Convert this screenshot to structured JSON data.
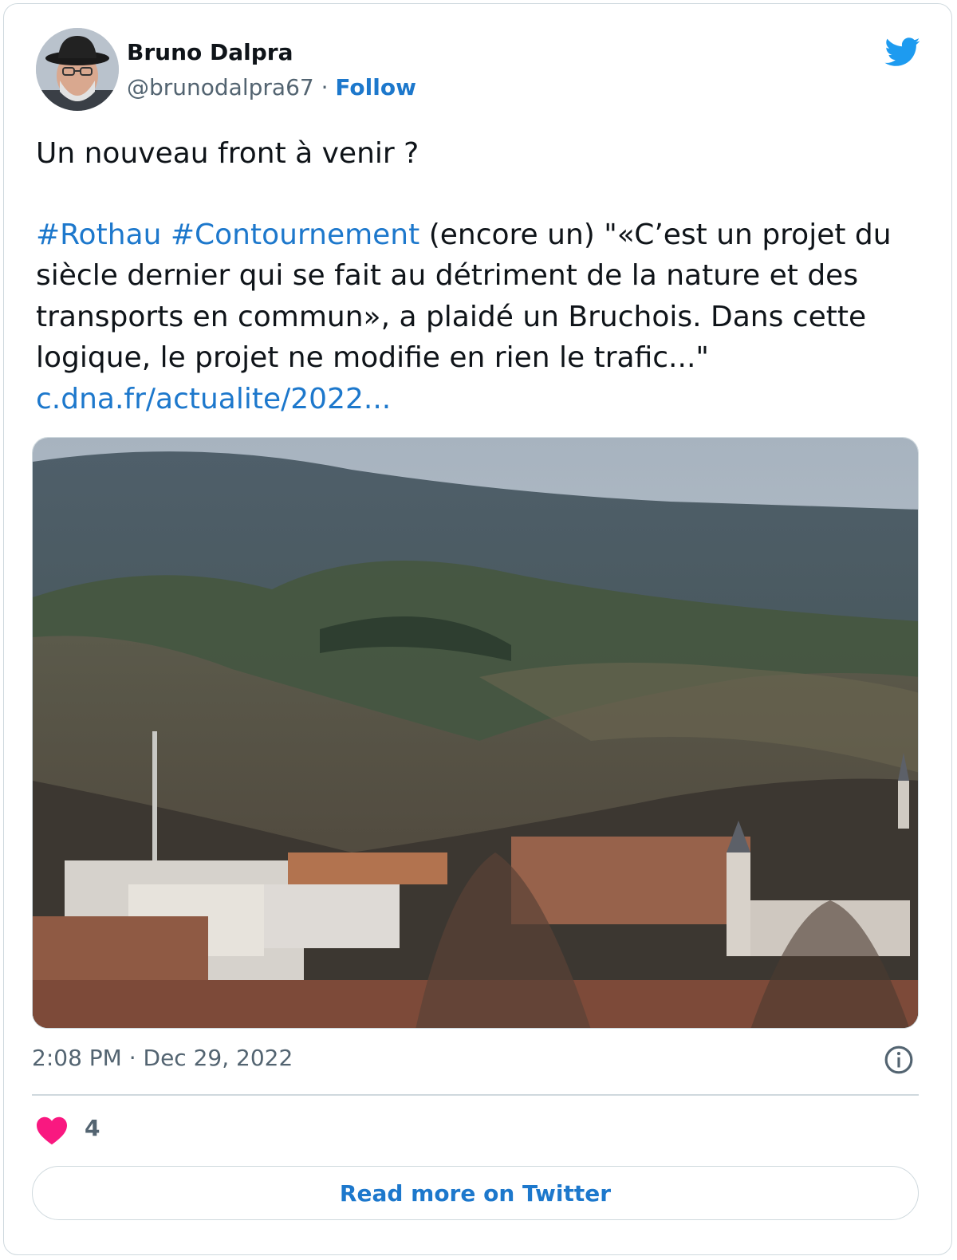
{
  "tweet": {
    "author": {
      "name": "Bruno Dalpra",
      "handle": "@brunodalpra67",
      "separator": " · ",
      "follow_label": "Follow"
    },
    "text": {
      "line1": "Un nouveau front à venir ?",
      "hashtags": [
        "#Rothau",
        "#Contournement"
      ],
      "body": " (encore un) \"«C’est un projet du siècle dernier qui se fait au détriment de la nature et des transports en commun», a plaidé un Bruchois. Dans cette logique, le projet ne modifie en rien le trafic...\"",
      "link": "c.dna.fr/actualite/2022..."
    },
    "timestamp": "2:08 PM · Dec 29, 2022",
    "likes": "4",
    "read_more_label": "Read more on Twitter"
  },
  "icons": {
    "brand": "twitter-bird-icon",
    "info": "info-icon",
    "like": "heart-icon"
  },
  "colors": {
    "accent": "#1d78cc",
    "twitter_blue": "#1d9bf0",
    "heart": "#f91880",
    "muted": "#536471",
    "border": "#cfd9de"
  }
}
